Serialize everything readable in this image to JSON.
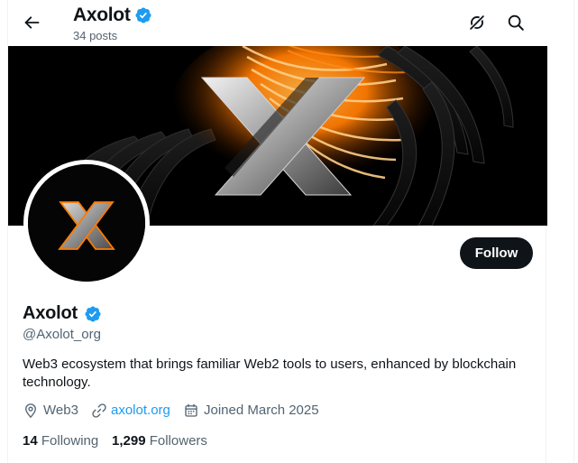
{
  "header": {
    "name": "Axolot",
    "posts_count": "34 posts"
  },
  "profile": {
    "name": "Axolot",
    "handle": "@Axolot_org",
    "bio": "Web3 ecosystem that brings familiar Web2 tools to users, enhanced by blockchain technology.",
    "location": "Web3",
    "website": "axolot.org",
    "joined": "Joined March 2025",
    "following_count": "14",
    "following_label": "Following",
    "followers_count": "1,299",
    "followers_label": "Followers",
    "follow_label": "Follow",
    "verified": true
  },
  "icons": {
    "back": "arrow-left-icon",
    "grok": "grok-icon",
    "search": "search-icon",
    "verified": "verified-badge-icon",
    "location": "location-pin-icon",
    "link": "link-icon",
    "calendar": "calendar-icon"
  },
  "colors": {
    "accent": "#1d9bf0",
    "text": "#0f1419",
    "muted": "#536471",
    "banner_glow": "#ff7a00"
  }
}
